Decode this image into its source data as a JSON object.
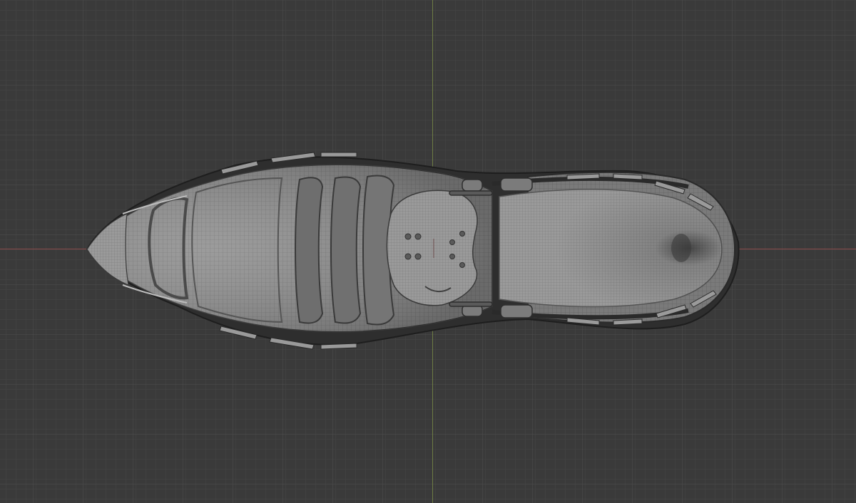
{
  "viewport": {
    "background_color": "#3a3a3a",
    "grid_minor_color": "#474747",
    "grid_major_color": "#505050",
    "axis_x_color": "#8a4a4a",
    "axis_y_color": "#6e7d44",
    "view": "top-orthographic",
    "shading": "solid-wireframe"
  },
  "model": {
    "object_type": "sneaker",
    "base_color": "#8c8c8c",
    "wire_color": "#5f5f5f",
    "shadow_color": "#2a2a2a",
    "highlight_color": "#b4b4b4"
  }
}
